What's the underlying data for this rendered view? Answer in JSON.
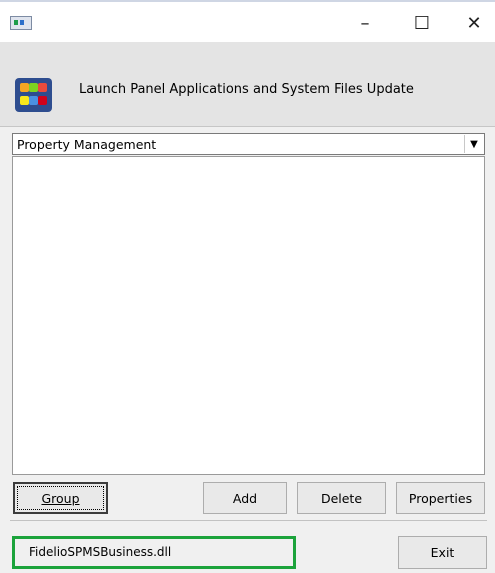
{
  "window": {
    "min_glyph": "–",
    "max_glyph": "☐",
    "close_glyph": "✕"
  },
  "header": {
    "title": "Launch Panel Applications and System Files Update",
    "icon": "launch-panel-icon"
  },
  "group_select": {
    "selected": "Property Management"
  },
  "buttons": {
    "group": "Group",
    "add": "Add",
    "delete": "Delete",
    "properties": "Properties",
    "exit": "Exit"
  },
  "status": {
    "text": "FidelioSPMSBusiness.dll",
    "highlight_color": "#1ba33b"
  }
}
